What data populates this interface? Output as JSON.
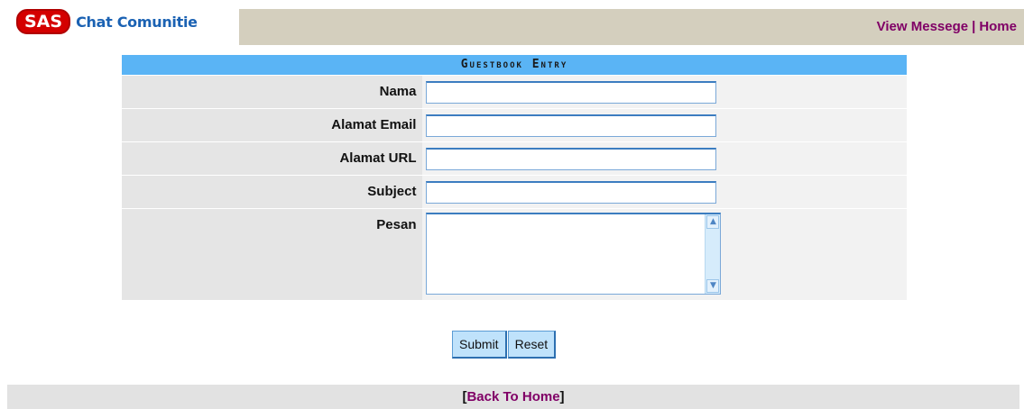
{
  "brand": {
    "logo_badge": "SAS",
    "logo_text": "Chat Comunitie"
  },
  "nav": {
    "view_message": "View Messege",
    "separator": "|",
    "home": "Home"
  },
  "form": {
    "title": "Guestbook Entry",
    "fields": [
      {
        "label": "Nama",
        "value": ""
      },
      {
        "label": "Alamat Email",
        "value": ""
      },
      {
        "label": "Alamat URL",
        "value": ""
      },
      {
        "label": "Subject",
        "value": ""
      },
      {
        "label": "Pesan",
        "value": ""
      }
    ],
    "submit_label": "Submit",
    "reset_label": "Reset"
  },
  "footer": {
    "open_bracket": "[",
    "link_label": "Back To Home",
    "close_bracket": "]"
  },
  "icons": {
    "scroll_up": "chevron-up-icon",
    "scroll_down": "chevron-down-icon"
  },
  "colors": {
    "header_blue": "#5ab4f5",
    "nav_band": "#d4cfbe",
    "link_purple": "#800066",
    "logo_red": "#d40000",
    "logo_blue": "#1b62b3",
    "button_bg": "#bfe2fb"
  }
}
